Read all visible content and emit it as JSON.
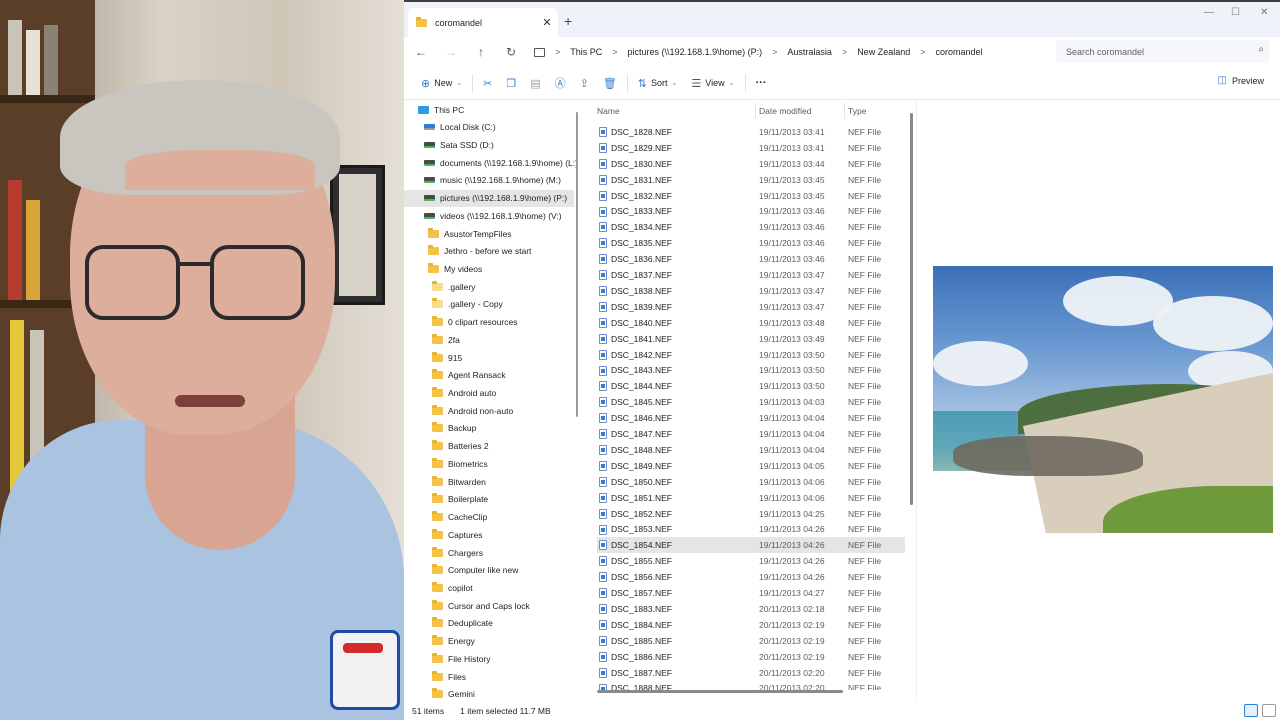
{
  "window": {
    "tab_title": "coromandel",
    "tab_close": "✕",
    "new_tab": "+",
    "controls": {
      "minimize": "—",
      "maximize": "☐",
      "close": "✕"
    }
  },
  "navigation": {
    "back": "←",
    "forward": "→",
    "up": "↑",
    "refresh": "↻",
    "breadcrumb": [
      "This PC",
      "pictures (\\\\192.168.1.9\\home) (P:)",
      "Australasia",
      "New Zealand",
      "coromandel"
    ],
    "separator": ">",
    "search_placeholder": "Search coromandel"
  },
  "toolbar": {
    "new_label": "New",
    "sort_label": "Sort",
    "view_label": "View",
    "more_label": "···",
    "preview_label": "Preview"
  },
  "nav_pane": {
    "items": [
      {
        "label": "This PC",
        "kind": "monitor"
      },
      {
        "label": "Local Disk (C:)",
        "kind": "drive-win"
      },
      {
        "label": "Sata SSD (D:)",
        "kind": "drive"
      },
      {
        "label": "documents (\\\\192.168.1.9\\home) (L:)",
        "kind": "drive"
      },
      {
        "label": "music (\\\\192.168.1.9\\home) (M:)",
        "kind": "drive"
      },
      {
        "label": "pictures (\\\\192.168.1.9\\home) (P:)",
        "kind": "drive",
        "selected": true
      },
      {
        "label": "videos (\\\\192.168.1.9\\home) (V:)",
        "kind": "drive"
      },
      {
        "label": "AsustorTempFiles",
        "kind": "folder"
      },
      {
        "label": "Jethro - before we start",
        "kind": "folder"
      },
      {
        "label": "My videos",
        "kind": "folder"
      },
      {
        "label": ".gallery",
        "kind": "folder-light"
      },
      {
        "label": ".gallery - Copy",
        "kind": "folder-light"
      },
      {
        "label": "0 clipart resources",
        "kind": "folder"
      },
      {
        "label": "2fa",
        "kind": "folder"
      },
      {
        "label": "915",
        "kind": "folder"
      },
      {
        "label": "Agent Ransack",
        "kind": "folder"
      },
      {
        "label": "Android auto",
        "kind": "folder"
      },
      {
        "label": "Android non-auto",
        "kind": "folder"
      },
      {
        "label": "Backup",
        "kind": "folder"
      },
      {
        "label": "Batteries 2",
        "kind": "folder"
      },
      {
        "label": "Biometrics",
        "kind": "folder"
      },
      {
        "label": "Bitwarden",
        "kind": "folder"
      },
      {
        "label": "Boilerplate",
        "kind": "folder"
      },
      {
        "label": "CacheClip",
        "kind": "folder"
      },
      {
        "label": "Captures",
        "kind": "folder"
      },
      {
        "label": "Chargers",
        "kind": "folder"
      },
      {
        "label": "Computer like new",
        "kind": "folder"
      },
      {
        "label": "copilot",
        "kind": "folder"
      },
      {
        "label": "Cursor and Caps lock",
        "kind": "folder"
      },
      {
        "label": "Deduplicate",
        "kind": "folder"
      },
      {
        "label": "Energy",
        "kind": "folder"
      },
      {
        "label": "File History",
        "kind": "folder"
      },
      {
        "label": "Files",
        "kind": "folder"
      },
      {
        "label": "Gemini",
        "kind": "folder"
      }
    ]
  },
  "file_list": {
    "columns": {
      "name": "Name",
      "date": "Date modified",
      "type": "Type"
    },
    "rows": [
      {
        "name": "DSC_1828.NEF",
        "date": "19/11/2013 03:41",
        "type": "NEF File"
      },
      {
        "name": "DSC_1829.NEF",
        "date": "19/11/2013 03:41",
        "type": "NEF File"
      },
      {
        "name": "DSC_1830.NEF",
        "date": "19/11/2013 03:44",
        "type": "NEF File"
      },
      {
        "name": "DSC_1831.NEF",
        "date": "19/11/2013 03:45",
        "type": "NEF File"
      },
      {
        "name": "DSC_1832.NEF",
        "date": "19/11/2013 03:45",
        "type": "NEF File"
      },
      {
        "name": "DSC_1833.NEF",
        "date": "19/11/2013 03:46",
        "type": "NEF File"
      },
      {
        "name": "DSC_1834.NEF",
        "date": "19/11/2013 03:46",
        "type": "NEF File"
      },
      {
        "name": "DSC_1835.NEF",
        "date": "19/11/2013 03:46",
        "type": "NEF File"
      },
      {
        "name": "DSC_1836.NEF",
        "date": "19/11/2013 03:46",
        "type": "NEF File"
      },
      {
        "name": "DSC_1837.NEF",
        "date": "19/11/2013 03:47",
        "type": "NEF File"
      },
      {
        "name": "DSC_1838.NEF",
        "date": "19/11/2013 03:47",
        "type": "NEF File"
      },
      {
        "name": "DSC_1839.NEF",
        "date": "19/11/2013 03:47",
        "type": "NEF File"
      },
      {
        "name": "DSC_1840.NEF",
        "date": "19/11/2013 03:48",
        "type": "NEF File"
      },
      {
        "name": "DSC_1841.NEF",
        "date": "19/11/2013 03:49",
        "type": "NEF File"
      },
      {
        "name": "DSC_1842.NEF",
        "date": "19/11/2013 03:50",
        "type": "NEF File"
      },
      {
        "name": "DSC_1843.NEF",
        "date": "19/11/2013 03:50",
        "type": "NEF File"
      },
      {
        "name": "DSC_1844.NEF",
        "date": "19/11/2013 03:50",
        "type": "NEF File"
      },
      {
        "name": "DSC_1845.NEF",
        "date": "19/11/2013 04:03",
        "type": "NEF File"
      },
      {
        "name": "DSC_1846.NEF",
        "date": "19/11/2013 04:04",
        "type": "NEF File"
      },
      {
        "name": "DSC_1847.NEF",
        "date": "19/11/2013 04:04",
        "type": "NEF File"
      },
      {
        "name": "DSC_1848.NEF",
        "date": "19/11/2013 04:04",
        "type": "NEF File"
      },
      {
        "name": "DSC_1849.NEF",
        "date": "19/11/2013 04:05",
        "type": "NEF File"
      },
      {
        "name": "DSC_1850.NEF",
        "date": "19/11/2013 04:06",
        "type": "NEF File"
      },
      {
        "name": "DSC_1851.NEF",
        "date": "19/11/2013 04:06",
        "type": "NEF File"
      },
      {
        "name": "DSC_1852.NEF",
        "date": "19/11/2013 04:25",
        "type": "NEF File"
      },
      {
        "name": "DSC_1853.NEF",
        "date": "19/11/2013 04:26",
        "type": "NEF File"
      },
      {
        "name": "DSC_1854.NEF",
        "date": "19/11/2013 04:26",
        "type": "NEF File",
        "selected": true
      },
      {
        "name": "DSC_1855.NEF",
        "date": "19/11/2013 04:26",
        "type": "NEF File"
      },
      {
        "name": "DSC_1856.NEF",
        "date": "19/11/2013 04:26",
        "type": "NEF File"
      },
      {
        "name": "DSC_1857.NEF",
        "date": "19/11/2013 04:27",
        "type": "NEF File"
      },
      {
        "name": "DSC_1883.NEF",
        "date": "20/11/2013 02:18",
        "type": "NEF File"
      },
      {
        "name": "DSC_1884.NEF",
        "date": "20/11/2013 02:19",
        "type": "NEF File"
      },
      {
        "name": "DSC_1885.NEF",
        "date": "20/11/2013 02:19",
        "type": "NEF File"
      },
      {
        "name": "DSC_1886.NEF",
        "date": "20/11/2013 02:19",
        "type": "NEF File"
      },
      {
        "name": "DSC_1887.NEF",
        "date": "20/11/2013 02:20",
        "type": "NEF File"
      },
      {
        "name": "DSC_1888.NEF",
        "date": "20/11/2013 02:20",
        "type": "NEF File"
      }
    ]
  },
  "status_bar": {
    "item_count": "51 items",
    "selection": "1 item selected  11.7 MB"
  },
  "colors": {
    "accent": "#2a7fd4",
    "folder": "#f4c248",
    "selection": "#e5e5e5"
  }
}
